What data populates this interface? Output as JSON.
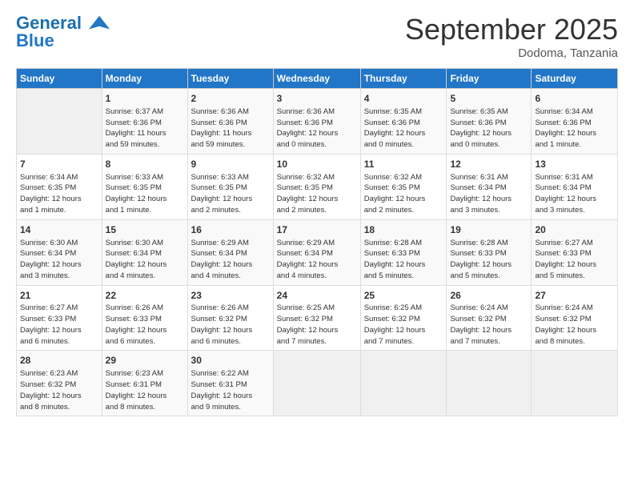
{
  "header": {
    "logo_line1": "General",
    "logo_line2": "Blue",
    "month": "September 2025",
    "location": "Dodoma, Tanzania"
  },
  "days_of_week": [
    "Sunday",
    "Monday",
    "Tuesday",
    "Wednesday",
    "Thursday",
    "Friday",
    "Saturday"
  ],
  "weeks": [
    [
      {
        "day": "",
        "info": ""
      },
      {
        "day": "1",
        "info": "Sunrise: 6:37 AM\nSunset: 6:36 PM\nDaylight: 11 hours\nand 59 minutes."
      },
      {
        "day": "2",
        "info": "Sunrise: 6:36 AM\nSunset: 6:36 PM\nDaylight: 11 hours\nand 59 minutes."
      },
      {
        "day": "3",
        "info": "Sunrise: 6:36 AM\nSunset: 6:36 PM\nDaylight: 12 hours\nand 0 minutes."
      },
      {
        "day": "4",
        "info": "Sunrise: 6:35 AM\nSunset: 6:36 PM\nDaylight: 12 hours\nand 0 minutes."
      },
      {
        "day": "5",
        "info": "Sunrise: 6:35 AM\nSunset: 6:36 PM\nDaylight: 12 hours\nand 0 minutes."
      },
      {
        "day": "6",
        "info": "Sunrise: 6:34 AM\nSunset: 6:36 PM\nDaylight: 12 hours\nand 1 minute."
      }
    ],
    [
      {
        "day": "7",
        "info": "Sunrise: 6:34 AM\nSunset: 6:35 PM\nDaylight: 12 hours\nand 1 minute."
      },
      {
        "day": "8",
        "info": "Sunrise: 6:33 AM\nSunset: 6:35 PM\nDaylight: 12 hours\nand 1 minute."
      },
      {
        "day": "9",
        "info": "Sunrise: 6:33 AM\nSunset: 6:35 PM\nDaylight: 12 hours\nand 2 minutes."
      },
      {
        "day": "10",
        "info": "Sunrise: 6:32 AM\nSunset: 6:35 PM\nDaylight: 12 hours\nand 2 minutes."
      },
      {
        "day": "11",
        "info": "Sunrise: 6:32 AM\nSunset: 6:35 PM\nDaylight: 12 hours\nand 2 minutes."
      },
      {
        "day": "12",
        "info": "Sunrise: 6:31 AM\nSunset: 6:34 PM\nDaylight: 12 hours\nand 3 minutes."
      },
      {
        "day": "13",
        "info": "Sunrise: 6:31 AM\nSunset: 6:34 PM\nDaylight: 12 hours\nand 3 minutes."
      }
    ],
    [
      {
        "day": "14",
        "info": "Sunrise: 6:30 AM\nSunset: 6:34 PM\nDaylight: 12 hours\nand 3 minutes."
      },
      {
        "day": "15",
        "info": "Sunrise: 6:30 AM\nSunset: 6:34 PM\nDaylight: 12 hours\nand 4 minutes."
      },
      {
        "day": "16",
        "info": "Sunrise: 6:29 AM\nSunset: 6:34 PM\nDaylight: 12 hours\nand 4 minutes."
      },
      {
        "day": "17",
        "info": "Sunrise: 6:29 AM\nSunset: 6:34 PM\nDaylight: 12 hours\nand 4 minutes."
      },
      {
        "day": "18",
        "info": "Sunrise: 6:28 AM\nSunset: 6:33 PM\nDaylight: 12 hours\nand 5 minutes."
      },
      {
        "day": "19",
        "info": "Sunrise: 6:28 AM\nSunset: 6:33 PM\nDaylight: 12 hours\nand 5 minutes."
      },
      {
        "day": "20",
        "info": "Sunrise: 6:27 AM\nSunset: 6:33 PM\nDaylight: 12 hours\nand 5 minutes."
      }
    ],
    [
      {
        "day": "21",
        "info": "Sunrise: 6:27 AM\nSunset: 6:33 PM\nDaylight: 12 hours\nand 6 minutes."
      },
      {
        "day": "22",
        "info": "Sunrise: 6:26 AM\nSunset: 6:33 PM\nDaylight: 12 hours\nand 6 minutes."
      },
      {
        "day": "23",
        "info": "Sunrise: 6:26 AM\nSunset: 6:32 PM\nDaylight: 12 hours\nand 6 minutes."
      },
      {
        "day": "24",
        "info": "Sunrise: 6:25 AM\nSunset: 6:32 PM\nDaylight: 12 hours\nand 7 minutes."
      },
      {
        "day": "25",
        "info": "Sunrise: 6:25 AM\nSunset: 6:32 PM\nDaylight: 12 hours\nand 7 minutes."
      },
      {
        "day": "26",
        "info": "Sunrise: 6:24 AM\nSunset: 6:32 PM\nDaylight: 12 hours\nand 7 minutes."
      },
      {
        "day": "27",
        "info": "Sunrise: 6:24 AM\nSunset: 6:32 PM\nDaylight: 12 hours\nand 8 minutes."
      }
    ],
    [
      {
        "day": "28",
        "info": "Sunrise: 6:23 AM\nSunset: 6:32 PM\nDaylight: 12 hours\nand 8 minutes."
      },
      {
        "day": "29",
        "info": "Sunrise: 6:23 AM\nSunset: 6:31 PM\nDaylight: 12 hours\nand 8 minutes."
      },
      {
        "day": "30",
        "info": "Sunrise: 6:22 AM\nSunset: 6:31 PM\nDaylight: 12 hours\nand 9 minutes."
      },
      {
        "day": "",
        "info": ""
      },
      {
        "day": "",
        "info": ""
      },
      {
        "day": "",
        "info": ""
      },
      {
        "day": "",
        "info": ""
      }
    ]
  ]
}
